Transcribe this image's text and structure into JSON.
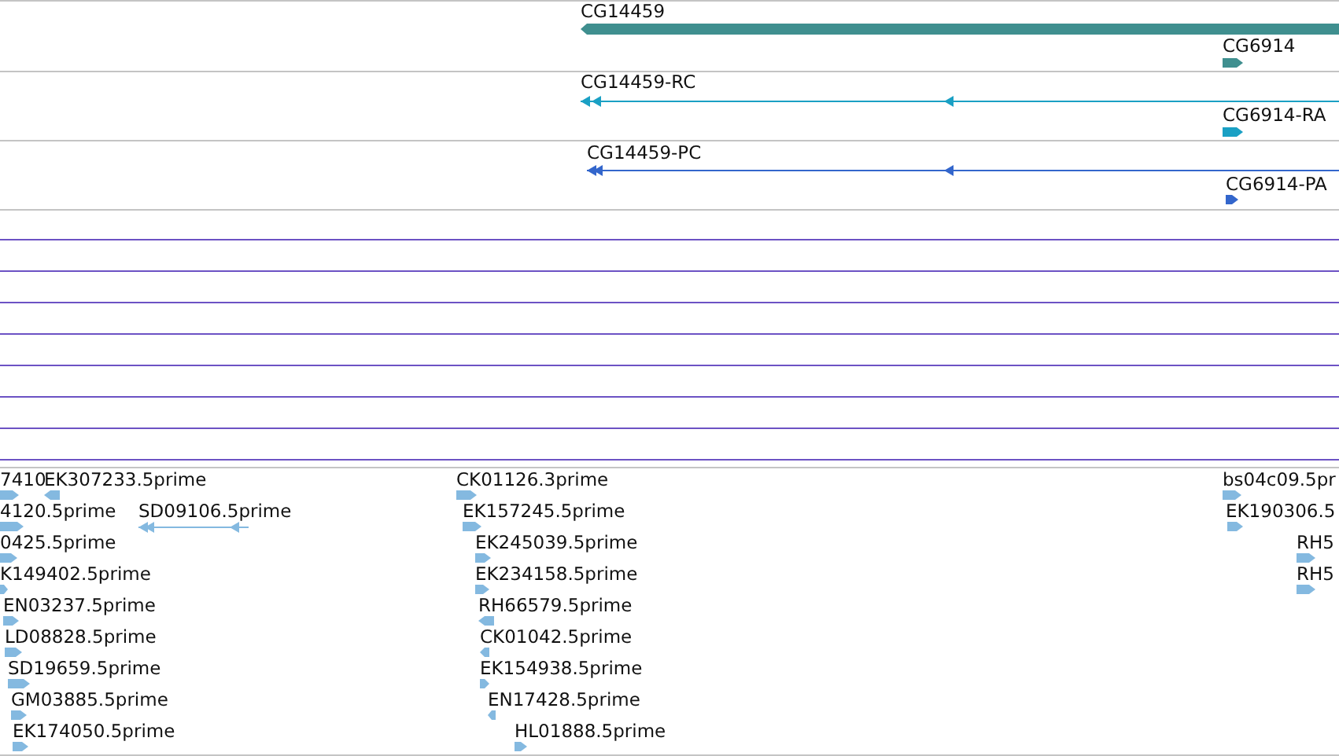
{
  "gene_tracks": [
    {
      "kind": "gene",
      "features": [
        {
          "label": "CG14459",
          "reverse": true
        },
        {
          "label": "CG6914",
          "reverse": false
        }
      ]
    },
    {
      "kind": "transcript",
      "features": [
        {
          "label": "CG14459-RC",
          "reverse": true
        },
        {
          "label": "CG6914-RA",
          "reverse": false
        }
      ]
    },
    {
      "kind": "protein",
      "features": [
        {
          "label": "CG14459-PC",
          "reverse": true
        },
        {
          "label": "CG6914-PA",
          "reverse": false
        }
      ]
    }
  ],
  "est_track": {
    "features": [
      {
        "label": "7410",
        "reverse": false
      },
      {
        "label": "EK307233.5prime",
        "reverse": true
      },
      {
        "label": "CK01126.3prime",
        "reverse": false
      },
      {
        "label": "bs04c09.5pr",
        "reverse": false
      },
      {
        "label": "4120.5prime",
        "reverse": false
      },
      {
        "label": "SD09106.5prime",
        "reverse": true
      },
      {
        "label": "EK157245.5prime",
        "reverse": false
      },
      {
        "label": "EK190306.5",
        "reverse": false
      },
      {
        "label": "0425.5prime",
        "reverse": false
      },
      {
        "label": "EK245039.5prime",
        "reverse": false
      },
      {
        "label": "RH5",
        "reverse": false
      },
      {
        "label": "K149402.5prime",
        "reverse": false
      },
      {
        "label": "EK234158.5prime",
        "reverse": false
      },
      {
        "label": "RH5",
        "reverse": false
      },
      {
        "label": "EN03237.5prime",
        "reverse": false
      },
      {
        "label": "RH66579.5prime",
        "reverse": true
      },
      {
        "label": "LD08828.5prime",
        "reverse": false
      },
      {
        "label": "CK01042.5prime",
        "reverse": true
      },
      {
        "label": "SD19659.5prime",
        "reverse": false
      },
      {
        "label": "EK154938.5prime",
        "reverse": false
      },
      {
        "label": "GM03885.5prime",
        "reverse": false
      },
      {
        "label": "EN17428.5prime",
        "reverse": true
      },
      {
        "label": "EK174050.5prime",
        "reverse": false
      },
      {
        "label": "HL01888.5prime",
        "reverse": false
      }
    ]
  }
}
